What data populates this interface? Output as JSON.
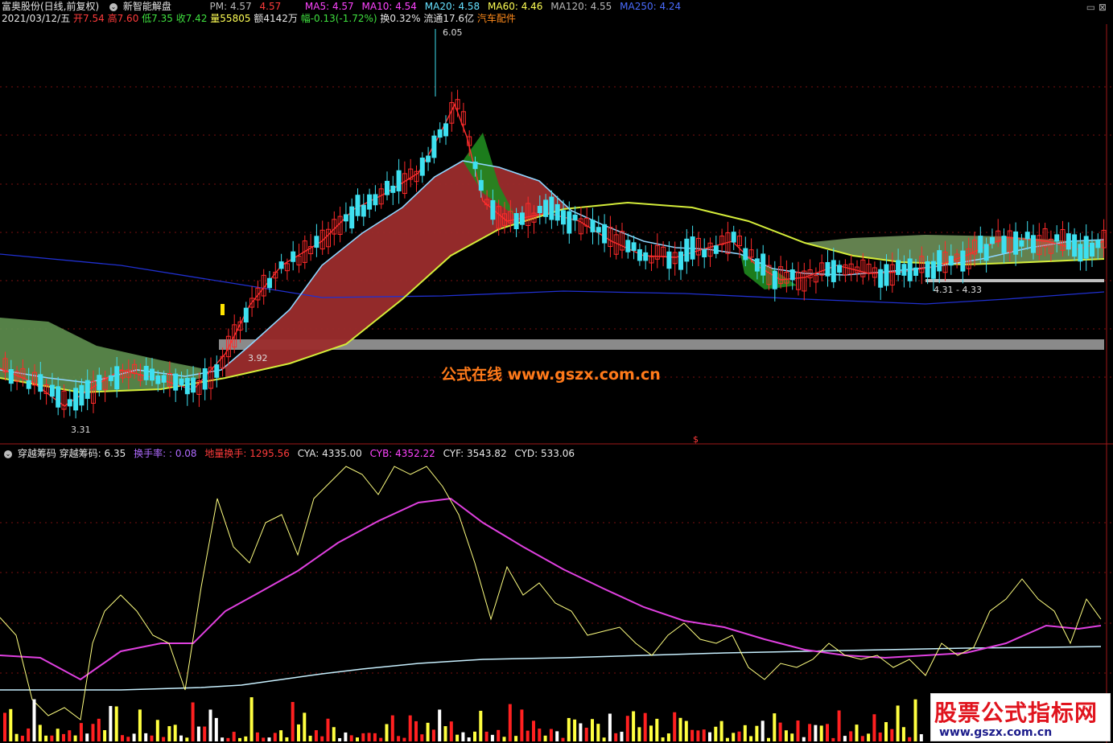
{
  "header": {
    "stock_name": "富奥股份(日线,前复权)",
    "indicator_name": "新智能解盘",
    "pm_label": "PM:",
    "pm_val1": "4.57",
    "pm_val2": "4.57",
    "ma5": "MA5: 4.57",
    "ma10": "MA10: 4.54",
    "ma20": "MA20: 4.58",
    "ma60": "MA60: 4.46",
    "ma120": "MA120: 4.55",
    "ma250": "MA250: 4.24"
  },
  "quote": {
    "date": "2021/03/12/五",
    "open": "开7.54",
    "high": "高7.60",
    "low": "低7.35",
    "close": "收7.42",
    "volume": "量55805",
    "amount": "额4142万",
    "change": "幅-0.13(-1.72%)",
    "turnover": "换0.32%",
    "float": "流通17.6亿",
    "sector": "汽车配件"
  },
  "annotations": {
    "peak": "6.05",
    "low1": "3.31",
    "mid": "3.92",
    "range": "4.31 - 4.33",
    "marker": "$"
  },
  "watermark": "公式在线  www.gszx.com.cn",
  "sub": {
    "title": "穿越筹码",
    "name": "穿越筹码:",
    "name_val": "6.35",
    "turn": "换手率:",
    "turn_val": ": 0.08",
    "ground": "地量换手:",
    "ground_val": "1295.56",
    "cya": "CYA: 4335.00",
    "cyb": "CYB: 4352.22",
    "cyf": "CYF: 3543.82",
    "cyd": "CYD: 533.06"
  },
  "brand": {
    "title": "股票公式指标网",
    "url": "www.gszx.com.cn"
  },
  "icons": [
    "selector-icon",
    "window-buttons-icon"
  ]
}
